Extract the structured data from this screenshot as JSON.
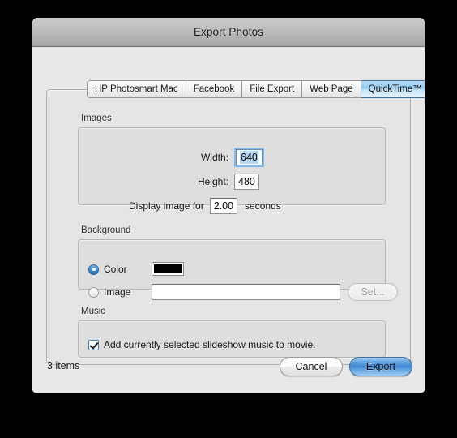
{
  "window": {
    "title": "Export Photos"
  },
  "tabs": [
    {
      "label": "HP Photosmart Mac",
      "selected": false
    },
    {
      "label": "Facebook",
      "selected": false
    },
    {
      "label": "File Export",
      "selected": false
    },
    {
      "label": "Web Page",
      "selected": false
    },
    {
      "label": "QuickTime™",
      "selected": true
    }
  ],
  "images_group": {
    "title": "Images",
    "width_label": "Width:",
    "width_value": "640",
    "height_label": "Height:",
    "height_value": "480",
    "delay_label": "Display image for",
    "delay_value": "2.00",
    "delay_suffix": "seconds"
  },
  "background_group": {
    "title": "Background",
    "color_label": "Color",
    "color_value": "#000000",
    "image_label": "Image",
    "image_path": "",
    "set_label": "Set..."
  },
  "music_group": {
    "title": "Music",
    "checkbox_label": "Add currently selected slideshow music to movie."
  },
  "footer": {
    "item_count": "3 items",
    "cancel_label": "Cancel",
    "export_label": "Export"
  },
  "colors": {
    "accent": "#3f86d2",
    "selection": "#b6d6f4",
    "tab_selected": "#8fc9ef"
  }
}
